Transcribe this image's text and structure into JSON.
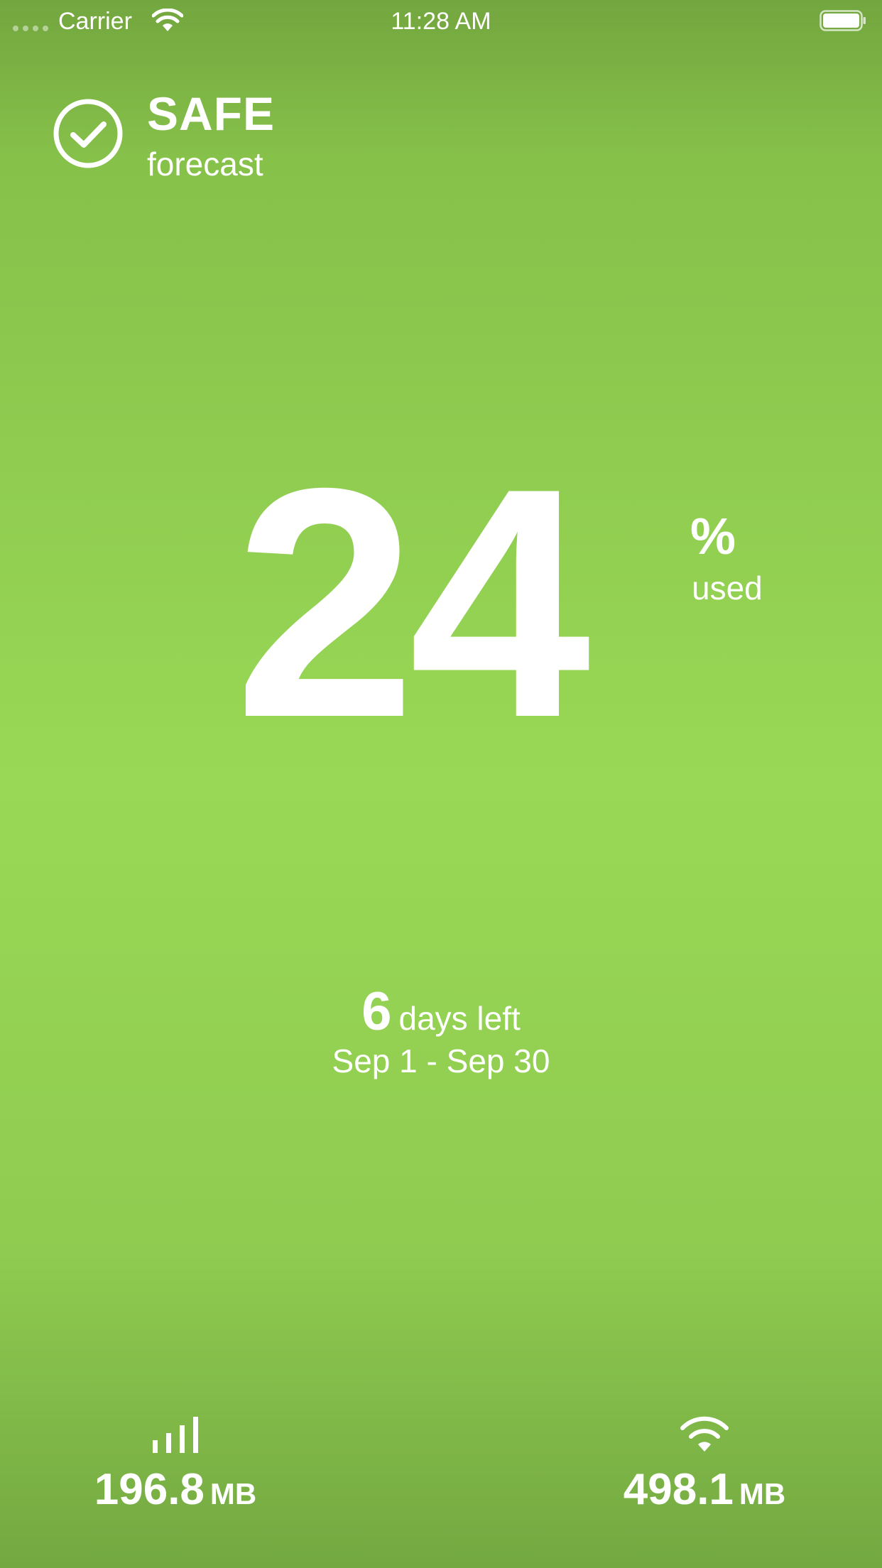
{
  "status_bar": {
    "carrier": "Carrier",
    "time": "11:28 AM"
  },
  "forecast": {
    "status": "SAFE",
    "label": "forecast",
    "icon": "checkmark-circle-icon"
  },
  "usage_summary": {
    "percent_used": "24",
    "percent_symbol": "%",
    "percent_label": "used"
  },
  "billing_period": {
    "days_left": "6",
    "days_left_label": "days left",
    "range": "Sep 1 - Sep 30"
  },
  "data_usage": {
    "cellular": {
      "icon": "cellular-bars-icon",
      "value": "196.8",
      "unit": "MB"
    },
    "wifi": {
      "icon": "wifi-icon",
      "value": "498.1",
      "unit": "MB"
    }
  },
  "colors": {
    "background_top": "#73a63f",
    "background_mid": "#99d856",
    "background_bottom": "#73a841",
    "foreground": "#ffffff"
  }
}
